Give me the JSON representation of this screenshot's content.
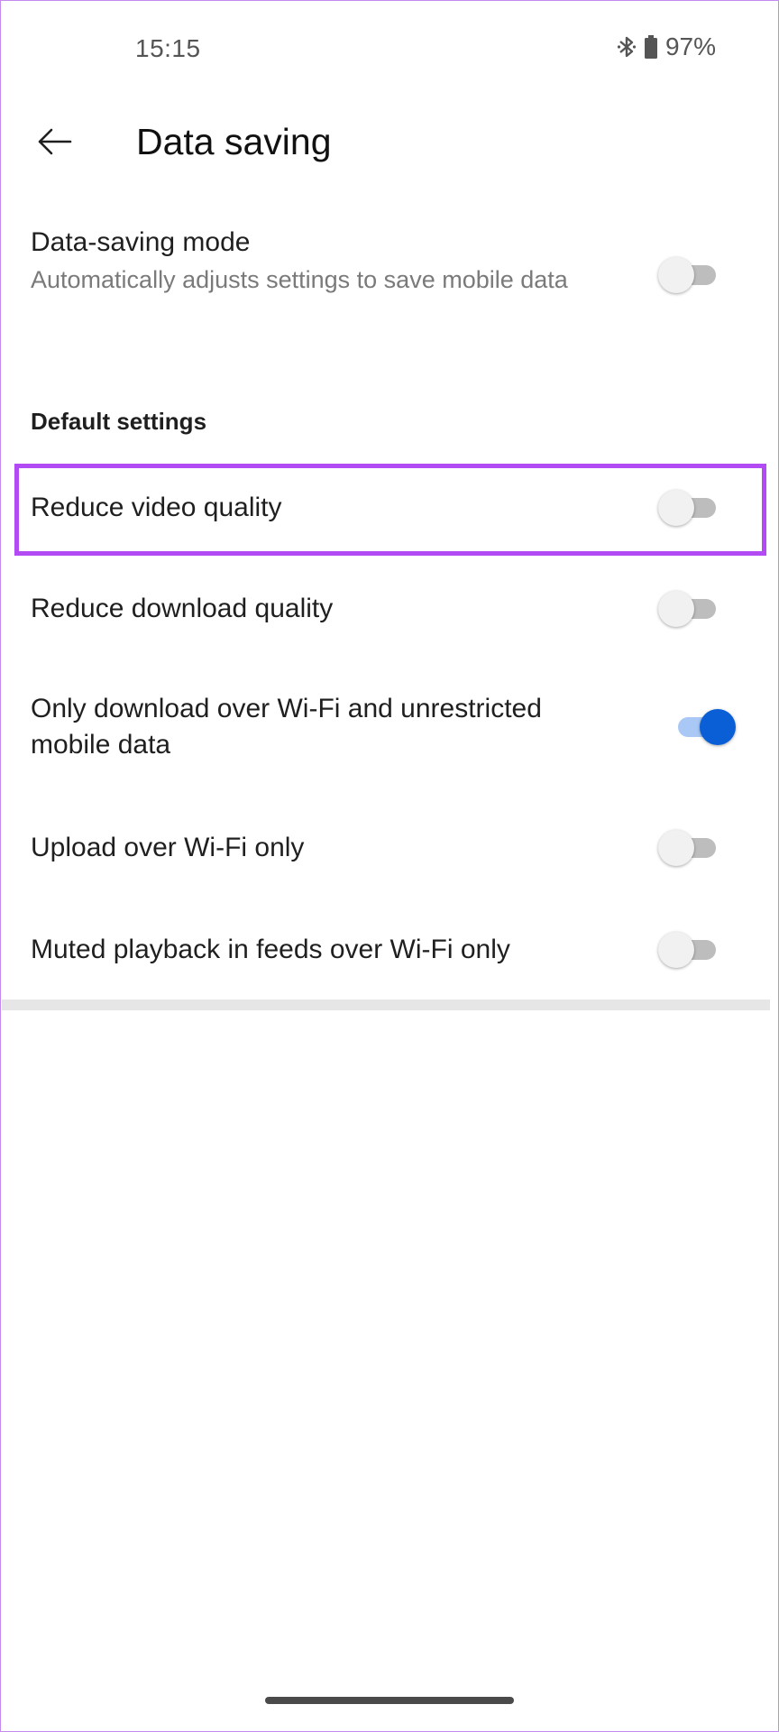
{
  "status_bar": {
    "time": "15:15",
    "battery": "97%"
  },
  "header": {
    "title": "Data saving"
  },
  "data_saving_mode": {
    "label": "Data-saving mode",
    "description": "Automatically adjusts settings to save mobile data",
    "enabled": false
  },
  "section": {
    "title": "Default settings"
  },
  "settings": [
    {
      "label": "Reduce video quality",
      "enabled": false
    },
    {
      "label": "Reduce download quality",
      "enabled": false
    },
    {
      "label": "Only download over Wi-Fi and unrestricted mobile data",
      "enabled": true
    },
    {
      "label": "Upload over Wi-Fi only",
      "enabled": false
    },
    {
      "label": "Muted playback in feeds over Wi-Fi only",
      "enabled": false
    }
  ],
  "colors": {
    "accent": "#0b5fd6",
    "highlight": "#b24bf3"
  }
}
